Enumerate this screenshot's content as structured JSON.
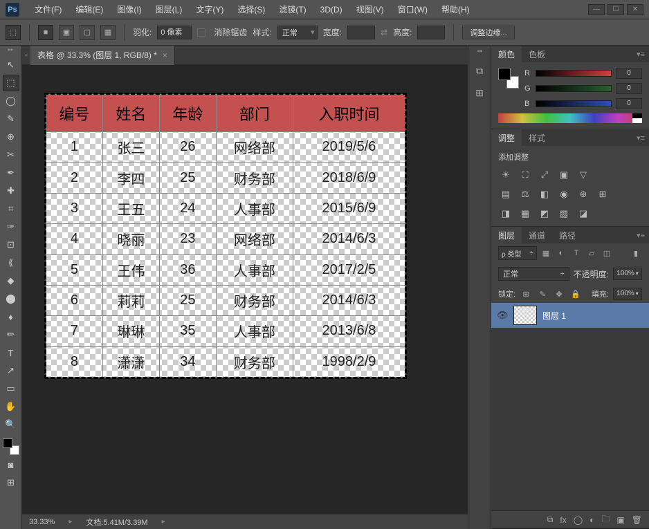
{
  "app": {
    "logo": "Ps"
  },
  "menu": [
    "文件(F)",
    "编辑(E)",
    "图像(I)",
    "图层(L)",
    "文字(Y)",
    "选择(S)",
    "滤镜(T)",
    "3D(D)",
    "视图(V)",
    "窗口(W)",
    "帮助(H)"
  ],
  "optbar": {
    "feather_label": "羽化:",
    "feather_value": "0 像素",
    "antialias": "消除锯齿",
    "style_label": "样式:",
    "style_value": "正常",
    "width_label": "宽度:",
    "height_label": "高度:",
    "refine": "调整边缘..."
  },
  "doc": {
    "tab_title": "表格 @ 33.3% (图层 1, RGB/8) *",
    "zoom": "33.33%",
    "docinfo": "文档:5.41M/3.39M"
  },
  "table": {
    "headers": [
      "编号",
      "姓名",
      "年龄",
      "部门",
      "入职时间"
    ],
    "rows": [
      [
        "1",
        "张三",
        "26",
        "网络部",
        "2019/5/6"
      ],
      [
        "2",
        "李四",
        "25",
        "财务部",
        "2018/6/9"
      ],
      [
        "3",
        "王五",
        "24",
        "人事部",
        "2015/6/9"
      ],
      [
        "4",
        "晓丽",
        "23",
        "网络部",
        "2014/6/3"
      ],
      [
        "5",
        "王伟",
        "36",
        "人事部",
        "2017/2/5"
      ],
      [
        "6",
        "莉莉",
        "25",
        "财务部",
        "2014/6/3"
      ],
      [
        "7",
        "琳琳",
        "35",
        "人事部",
        "2013/6/8"
      ],
      [
        "8",
        "潇潇",
        "34",
        "财务部",
        "1998/2/9"
      ]
    ]
  },
  "panels": {
    "color_tab": "颜色",
    "swatch_tab": "色板",
    "rgb": {
      "r_label": "R",
      "g_label": "G",
      "b_label": "B",
      "r": "0",
      "g": "0",
      "b": "0"
    },
    "adjust_tab": "调整",
    "styles_tab": "样式",
    "add_adjust": "添加调整",
    "layers_tab": "图层",
    "channels_tab": "通道",
    "paths_tab": "路径",
    "kind_label": "ρ 类型",
    "blend": "正常",
    "opacity_label": "不透明度:",
    "opacity": "100%",
    "lock_label": "锁定:",
    "fill_label": "填充:",
    "fill": "100%",
    "layer1": "图层 1"
  },
  "tools": [
    "↖",
    "⬚",
    "◯",
    "✎",
    "⊕",
    "✂",
    "✒",
    "✚",
    "⌗",
    "✑",
    "⊡",
    "⟪",
    "◆",
    "⬤",
    "♦",
    "✏",
    "T",
    "↗",
    "▭",
    "✋",
    "🔍"
  ]
}
